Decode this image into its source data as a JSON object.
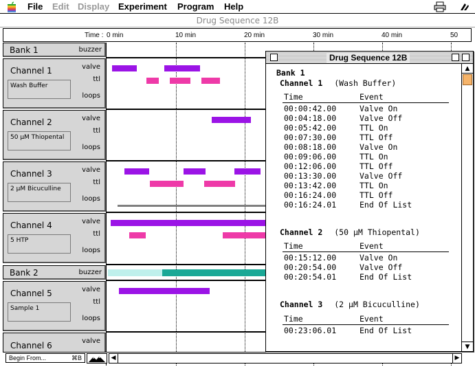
{
  "menubar": {
    "items": [
      {
        "label": "File",
        "enabled": true
      },
      {
        "label": "Edit",
        "enabled": false
      },
      {
        "label": "Display",
        "enabled": false
      },
      {
        "label": "Experiment",
        "enabled": true
      },
      {
        "label": "Program",
        "enabled": true
      },
      {
        "label": "Help",
        "enabled": true
      }
    ],
    "icons": [
      "apple-icon",
      "printer-icon",
      "application-icon"
    ]
  },
  "main_window": {
    "title": "Drug Sequence 12B",
    "timeline_header": {
      "prefix": "Time :",
      "ticks": [
        "0 min",
        "10 min",
        "20 min",
        "30 min",
        "40 min",
        "50"
      ]
    }
  },
  "rows": [
    {
      "type": "bank",
      "name": "Bank  1",
      "extra": "buzzer"
    },
    {
      "type": "channel",
      "name": "Channel  1",
      "label": "Wash Buffer",
      "tags": [
        "valve",
        "ttl",
        "loops"
      ]
    },
    {
      "type": "channel",
      "name": "Channel  2",
      "label": "50 µM Thiopental",
      "tags": [
        "valve",
        "ttl",
        "loops"
      ]
    },
    {
      "type": "channel",
      "name": "Channel  3",
      "label": "2 µM Bicuculline",
      "tags": [
        "valve",
        "ttl",
        "loops"
      ]
    },
    {
      "type": "channel",
      "name": "Channel  4",
      "label": "5 HTP",
      "tags": [
        "valve",
        "ttl",
        "loops"
      ]
    },
    {
      "type": "bank",
      "name": "Bank  2",
      "extra": "buzzer"
    },
    {
      "type": "channel",
      "name": "Channel  5",
      "label": "Sample 1",
      "tags": [
        "valve",
        "ttl",
        "loops"
      ]
    },
    {
      "type": "channel",
      "name": "Channel  6",
      "label": "",
      "tags": [
        "valve"
      ]
    }
  ],
  "statusbar": {
    "begin_from": "Begin From...",
    "shortcut": "⌘B"
  },
  "list_window": {
    "title": "Drug Sequence 12B",
    "bank": "Bank  1",
    "col_time": "Time",
    "col_event": "Event",
    "channels": [
      {
        "name": "Channel  1",
        "label": "(Wash Buffer)",
        "events": [
          {
            "time": "00:00:42.00",
            "event": "Valve On"
          },
          {
            "time": "00:04:18.00",
            "event": "Valve Off"
          },
          {
            "time": "00:05:42.00",
            "event": "TTL On"
          },
          {
            "time": "00:07:30.00",
            "event": "TTL Off"
          },
          {
            "time": "00:08:18.00",
            "event": "Valve On"
          },
          {
            "time": "00:09:06.00",
            "event": "TTL On"
          },
          {
            "time": "00:12:06.00",
            "event": "TTL Off"
          },
          {
            "time": "00:13:30.00",
            "event": "Valve Off"
          },
          {
            "time": "00:13:42.00",
            "event": "TTL On"
          },
          {
            "time": "00:16:24.00",
            "event": "TTL Off"
          },
          {
            "time": "00:16:24.01",
            "event": "End Of List"
          }
        ]
      },
      {
        "name": "Channel  2",
        "label": "(50 µM Thiopental)",
        "events": [
          {
            "time": "00:15:12.00",
            "event": "Valve On"
          },
          {
            "time": "00:20:54.00",
            "event": "Valve Off"
          },
          {
            "time": "00:20:54.01",
            "event": "End Of List"
          }
        ]
      },
      {
        "name": "Channel  3",
        "label": "(2 µM Bicuculline)",
        "events": [
          {
            "time": "00:23:06.01",
            "event": "End Of List"
          }
        ]
      }
    ]
  },
  "colors": {
    "valve": "#9b14e6",
    "ttl": "#ee3aa8",
    "buzzer": "#1aa896",
    "loop": "#7f7f7f",
    "scroll_thumb": "#f6b46a"
  }
}
